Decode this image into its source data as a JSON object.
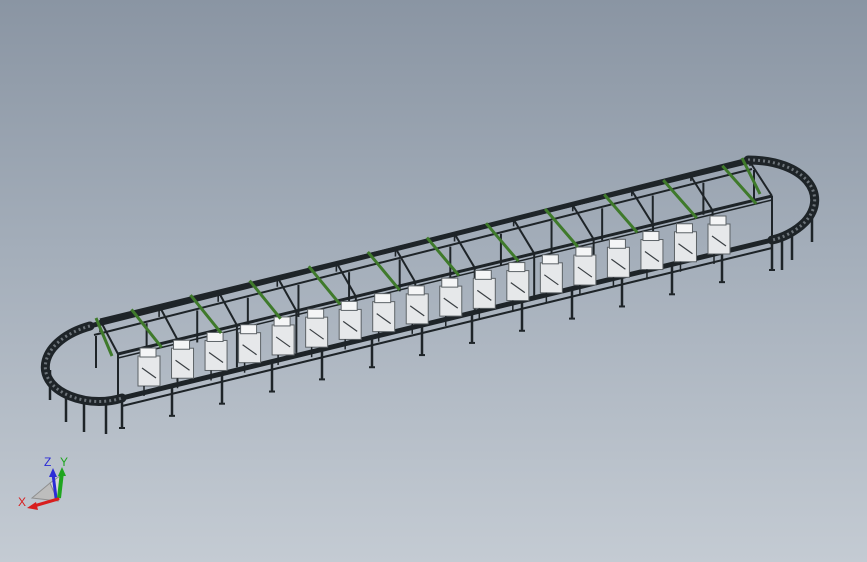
{
  "viewport": {
    "background_top": "#8a95a3",
    "background_bottom": "#c4cbd3"
  },
  "model": {
    "frame_color": "#1e2428",
    "brace_color": "#3f7a2b",
    "station_color": "#e6e8ea",
    "station_count": 18,
    "bay_count": 11
  },
  "triad": {
    "x_label": "X",
    "y_label": "Y",
    "z_label": "Z",
    "x_color": "#d81e1e",
    "y_color": "#1fa51f",
    "z_color": "#2b2bd6"
  }
}
